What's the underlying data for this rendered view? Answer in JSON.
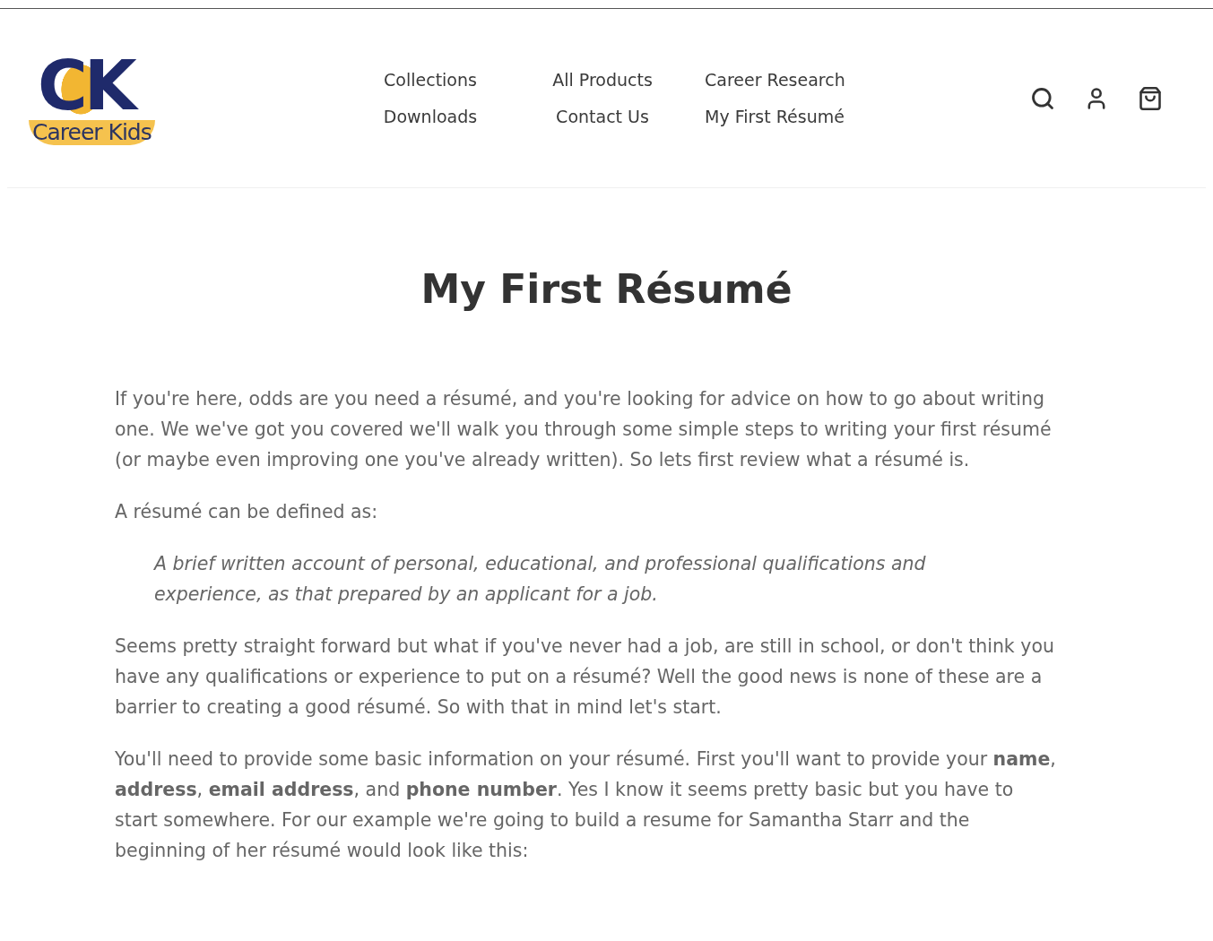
{
  "logo": {
    "initials": "CK",
    "name": "Career Kids"
  },
  "nav": [
    {
      "label": "Collections"
    },
    {
      "label": "All Products"
    },
    {
      "label": "Career Research"
    },
    {
      "label": "Downloads"
    },
    {
      "label": "Contact Us"
    },
    {
      "label": "My First Résumé"
    }
  ],
  "title": "My First Résumé",
  "content": [
    {
      "kind": "paragraph",
      "text": "If you're here, odds are you need a résumé, and you're looking for advice on how to go about writing one. We we've got you covered we'll walk you through some simple steps to writing your first résumé (or maybe even improving one you've already written).  So lets first review what a résumé is."
    },
    {
      "kind": "paragraph",
      "text": "A résumé can be defined as:"
    },
    {
      "kind": "quote",
      "text": "A brief written account of personal, educational, and professional qualifications and experience, as that prepared by an applicant for a job."
    },
    {
      "kind": "paragraph",
      "text": "Seems pretty straight forward but what if you've never had a job, are still in school, or don't think you have any qualifications or experience to put on a résumé?  Well the good news is none of these are a barrier to creating a good résumé.  So with that in mind let's start."
    },
    {
      "kind": "paragraph",
      "text": "You'll need to provide some basic information on your résumé.  First you'll want to provide your **name**, **address**, **email address**, and **phone number**.  Yes I know it seems pretty basic but you have to start somewhere.  For our example we're going to build a resume for Samantha Starr and the beginning of her résumé would look like this:"
    }
  ]
}
